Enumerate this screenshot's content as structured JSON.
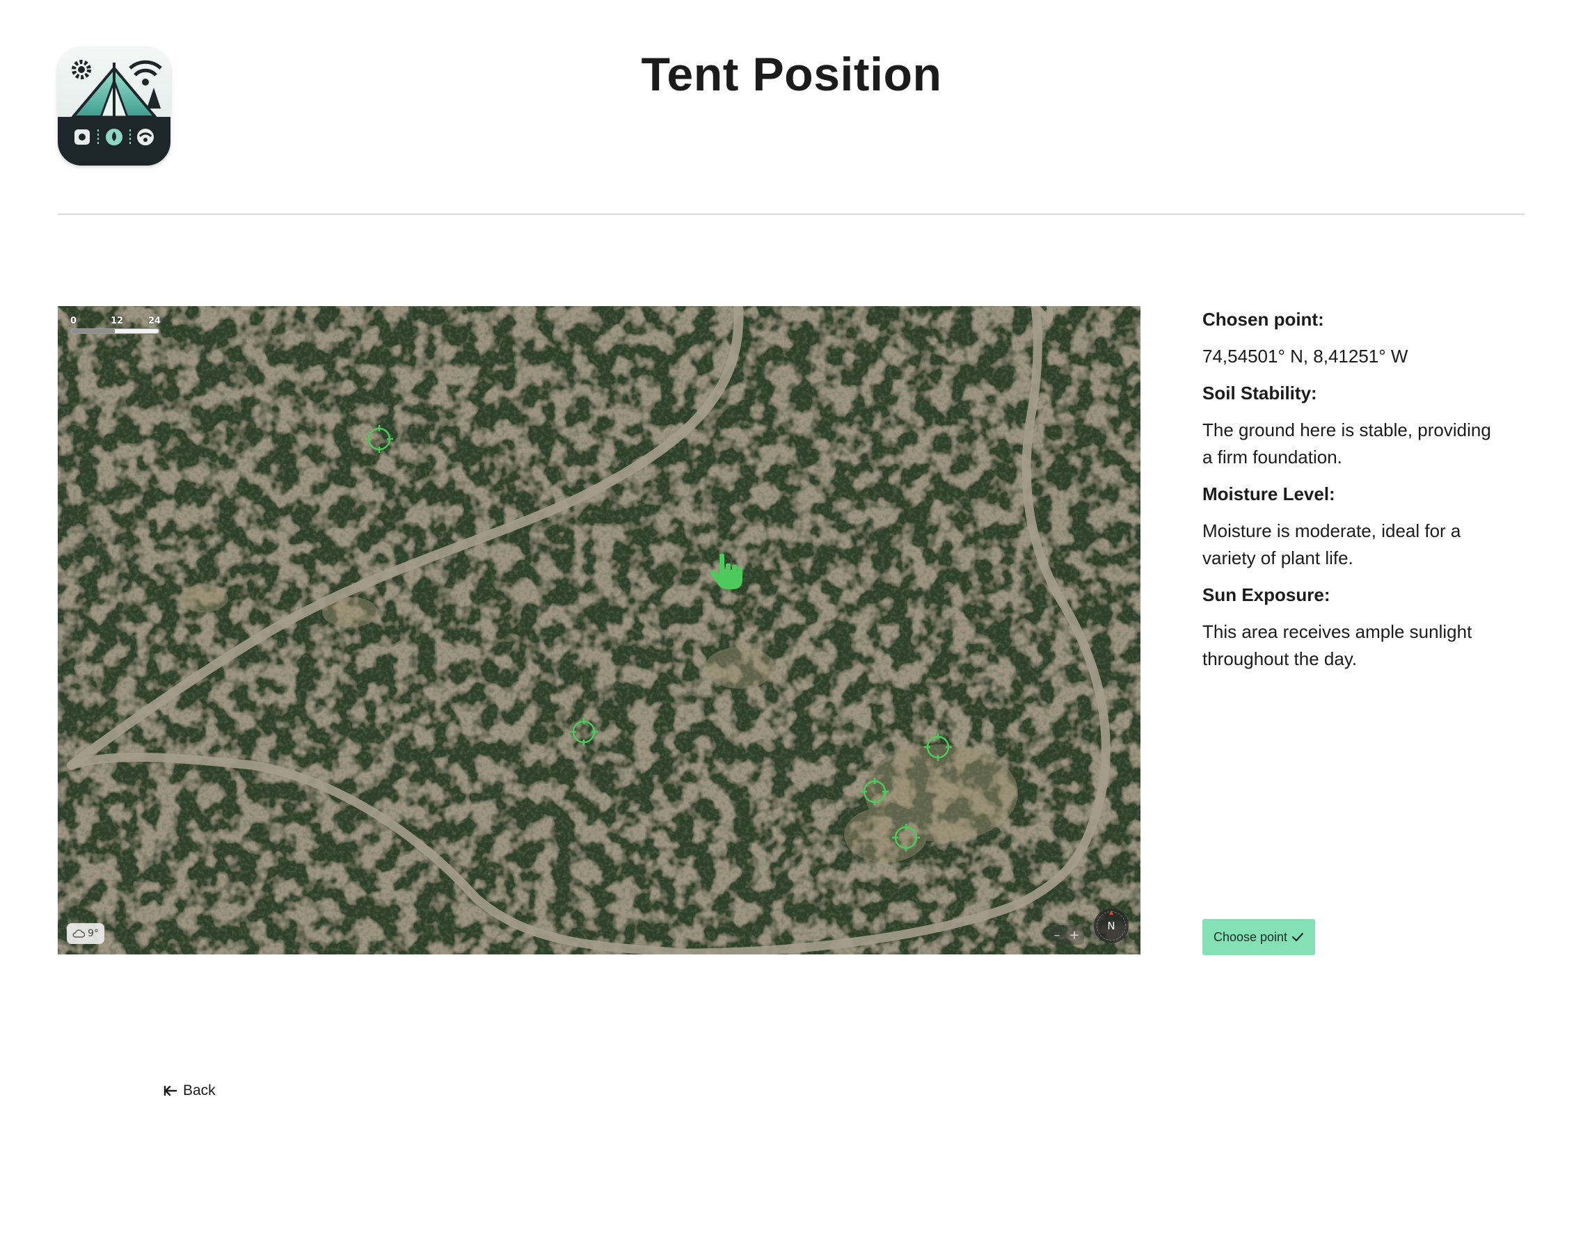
{
  "header": {
    "title": "Tent Position",
    "logo_icon": "camping-tent-logo-icon"
  },
  "map": {
    "scale": {
      "labels": [
        "0",
        "12",
        "24 m"
      ]
    },
    "weather": {
      "icon": "cloud-icon",
      "temperature": "9°"
    },
    "zoom": {
      "out_label": "–",
      "in_label": "+"
    },
    "compass_label": "N",
    "target_icon": "crosshair-target-icon",
    "target_color": "#4ec95c",
    "cursor_icon": "hand-pointer-icon"
  },
  "info": {
    "chosen_point_heading": "Chosen point:",
    "chosen_point_value": "74,54501° N, 8,41251° W",
    "soil_heading": "Soil Stability:",
    "soil_value": "The ground here is stable, providing a firm foundation.",
    "moisture_heading": "Moisture Level:",
    "moisture_value": "Moisture is moderate, ideal for a variety of plant life.",
    "sun_heading": "Sun Exposure:",
    "sun_value": "This area receives ample sunlight throughout the day."
  },
  "actions": {
    "choose_label": "Choose point",
    "choose_color": "#84e1b5",
    "back_label": "Back"
  }
}
